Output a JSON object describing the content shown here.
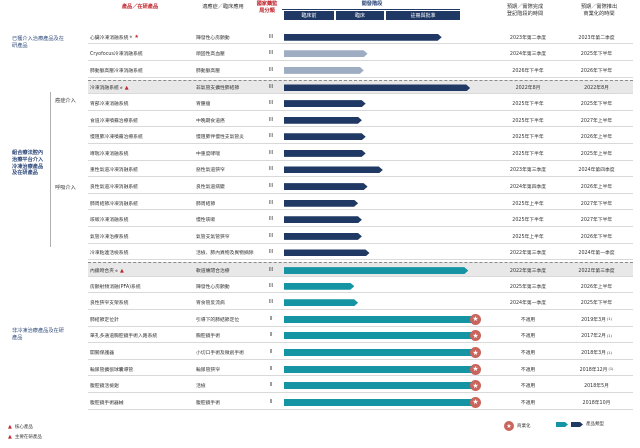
{
  "headers": {
    "product": "產品／在研產品",
    "indication": "適應症／臨床應用",
    "class": "國家藥監局分類",
    "progress": "開發階段",
    "expected_reg": "預期／實際完成\n登記階段的時間",
    "expected_comm": "預期／實際推出\n商業化的時間",
    "phases": [
      "臨床前",
      "臨床",
      "註冊與批准"
    ]
  },
  "groups": [
    {
      "label": "已獲介入治療產品及在研產品",
      "bold": false
    },
    {
      "label": "組合療法腔內治療平台介入冷凍治療產品及在研產品",
      "bold": true
    },
    {
      "label": "非冷凍治療產品及在研產品",
      "bold": false
    }
  ],
  "subgroups": [
    "癌症介入",
    "呼吸介入"
  ],
  "rows": [
    {
      "name": "心臟冷凍消融系統",
      "sup": "※",
      "star_marker": true,
      "indication": "陣發性心房顫動",
      "class": "III",
      "time1": "2023年第二季度",
      "time2": "2023年第二季度",
      "shade": false,
      "sep": false
    },
    {
      "name": "Cryofocus冷凍消融系統",
      "indication": "頑固性高血壓",
      "class": "III",
      "time1": "2024年第三季度",
      "time2": "2025年下半年",
      "shade": false
    },
    {
      "name": "肺動脈高壓冷凍消融系統",
      "indication": "肺動脈高壓",
      "class": "III",
      "time1": "2026年下半年",
      "time2": "2026年下半年",
      "shade": false
    },
    {
      "name": "冷凍消融系統",
      "sup": "※",
      "tri": true,
      "indication": "非氣管支擴性肺結節",
      "class": "III",
      "time1": "2022年8月",
      "time2": "2022年8月",
      "shade": true,
      "sep": true
    },
    {
      "name": "胃部冷凍消融系統",
      "indication": "胃腫瘤",
      "class": "III",
      "time1": "2025年下半年",
      "time2": "2025年下半年",
      "shade": false
    },
    {
      "name": "食道冷凍噴霧治療系統",
      "indication": "中晚期食道癌",
      "class": "III",
      "time1": "2025年下半年",
      "time2": "2027年上半年",
      "shade": false
    },
    {
      "name": "慢阻肺冷凍噴霧治療系統",
      "indication": "慢阻肺伴慢性支氣管炎",
      "class": "III",
      "time1": "2025年下半年",
      "time2": "2026年上半年",
      "shade": false
    },
    {
      "name": "哮喘冷凍消融系統",
      "indication": "中重度哮喘",
      "class": "III",
      "time1": "2025年下半年",
      "time2": "2025年上半年",
      "shade": false
    },
    {
      "name": "重性氣道冷凍消融系統",
      "indication": "惡性氣道狹窄",
      "class": "III",
      "time1": "2023年第三季度",
      "time2": "2024年第四季度",
      "shade": false
    },
    {
      "name": "良性氣道冷凍消融系統",
      "indication": "良性氣道病變",
      "class": "III",
      "time1": "2024年第四季度",
      "time2": "2026年上半年",
      "shade": false
    },
    {
      "name": "肺周結節冷凍消融系統",
      "indication": "肺周結節",
      "class": "III",
      "time1": "2025年上半年",
      "time2": "2027年下半年",
      "shade": false
    },
    {
      "name": "咳嗽冷凍消融系統",
      "indication": "慢性咳嗽",
      "class": "III",
      "time1": "2025年下半年",
      "time2": "2027年下半年",
      "shade": false
    },
    {
      "name": "氣管冷凍治療系統",
      "indication": "氣管支氣管狹窄",
      "class": "III",
      "time1": "2025年上半年",
      "time2": "2026年下半年",
      "shade": false
    },
    {
      "name": "冷凍粘連活檢系統",
      "indication": "活檢、肺內異物及異物摘除",
      "class": "III",
      "time1": "2022年第三季度",
      "time2": "2024年第一季度",
      "shade": false
    },
    {
      "name": "內鏡吻合夾",
      "sup": "※",
      "tri": true,
      "indication": "軟道瘻閉合治療",
      "class": "III",
      "time1": "2022年第三季度",
      "time2": "2022年第三季度",
      "shade": true,
      "sep": true
    },
    {
      "name": "房顫射頻消融(PFA)系統",
      "indication": "陣發性心房顫動",
      "class": "III",
      "time1": "2025年第三季度",
      "time2": "2026年上半年",
      "shade": false
    },
    {
      "name": "良性狹窄支架系統",
      "indication": "胃食管反流病",
      "class": "III",
      "time1": "2024年第一季度",
      "time2": "2025年下半年",
      "shade": false
    },
    {
      "name": "肺結節定位針",
      "indication": "引導下的肺結節定位",
      "class": "II",
      "time1": "不適用",
      "time2": "2019年3月",
      "t2sup": "(1)",
      "shade": false
    },
    {
      "name": "單孔多通道胸腔鏡手術入路系統",
      "indication": "胸腔鏡手術",
      "class": "II",
      "time1": "不適用",
      "time2": "2017年2月",
      "t2sup": "(1)",
      "shade": false
    },
    {
      "name": "開關保護器",
      "indication": "小切口手術及微創手術",
      "class": "II",
      "time1": "不適用",
      "time2": "2018年3月",
      "t2sup": "(1)",
      "shade": false
    },
    {
      "name": "輸尿管擴張球囊導管",
      "indication": "輸尿管狹窄",
      "class": "II",
      "time1": "不適用",
      "time2": "2018年12月",
      "t2sup": "(1)",
      "shade": false
    },
    {
      "name": "腹腔鏡活檢鉗",
      "indication": "活檢",
      "class": "II",
      "time1": "不適用",
      "time2": "2018年5月",
      "shade": false
    },
    {
      "name": "腹腔鏡手術器械",
      "indication": "腹腔鏡手術",
      "class": "II",
      "time1": "不適用",
      "time2": "2018年10月",
      "shade": false
    }
  ],
  "progress": [
    0.83,
    0.44,
    0.42,
    0.98,
    0.43,
    0.41,
    0.43,
    0.43,
    0.52,
    0.44,
    0.39,
    0.41,
    0.41,
    0.45,
    0.97,
    0.37,
    0.39,
    1.0,
    1.0,
    1.0,
    1.0,
    1.0,
    1.0
  ],
  "bar_colors": [
    "navy",
    "gray",
    "gray",
    "navy",
    "navy",
    "navy",
    "navy",
    "navy",
    "navy",
    "navy",
    "navy",
    "navy",
    "navy",
    "navy",
    "teal",
    "teal",
    "teal",
    "teal",
    "teal",
    "teal",
    "teal",
    "teal",
    "teal"
  ],
  "legend": {
    "core": "核心產品",
    "main": "主要在研產品",
    "commercialized": "商業化",
    "product_type": "產品類型"
  },
  "colors": {
    "navy": "#1f3864",
    "gray": "#9fadc3",
    "teal": "#1595a3",
    "red": "#c0262d",
    "star": "#c9655c"
  }
}
